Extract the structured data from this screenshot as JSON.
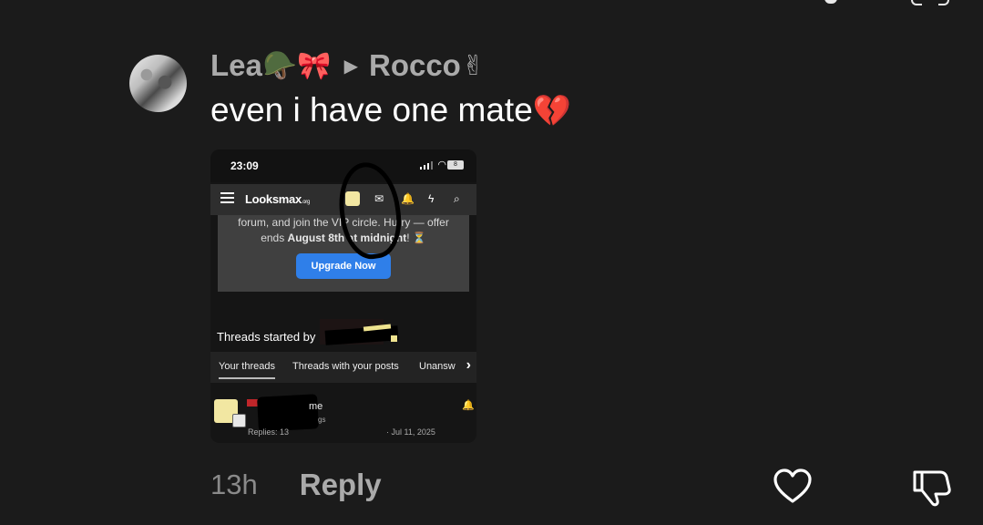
{
  "comment": {
    "author": "Lea",
    "author_emojis": "🪖🎀",
    "reply_to": "Rocco",
    "reply_to_emoji": "✌",
    "text": "even i have one mate",
    "text_emoji": "💔",
    "time": "13h",
    "reply_label": "Reply",
    "icons": {
      "like": "heart-icon",
      "dislike": "thumbs-down-icon",
      "reply_arrow": "triangle-right-icon"
    }
  },
  "screenshot": {
    "status_time": "23:09",
    "battery": "8",
    "site_logo": "Looksmax",
    "site_logo_suffix": ".org",
    "promo_line1": "forum, and join the VIP circle. Hurry — offer",
    "promo_line2_pre": "ends ",
    "promo_line2_bold": "August 8th at midnight",
    "promo_line2_post": "! ⏳",
    "upgrade_label": "Upgrade Now",
    "upgrade_color": "#2f7fe9",
    "threads_title": "Threads started by",
    "tabs": [
      "Your threads",
      "Threads with your posts",
      "Unansw"
    ],
    "thread": {
      "title_tail": "me",
      "sub_tail": "gs",
      "replies": "Replies: 13",
      "date": "· Jul 11, 2025"
    }
  },
  "colors": {
    "background": "#1b1b1b",
    "muted_text": "#aaaaaa",
    "time_text": "#8a8a8a"
  }
}
